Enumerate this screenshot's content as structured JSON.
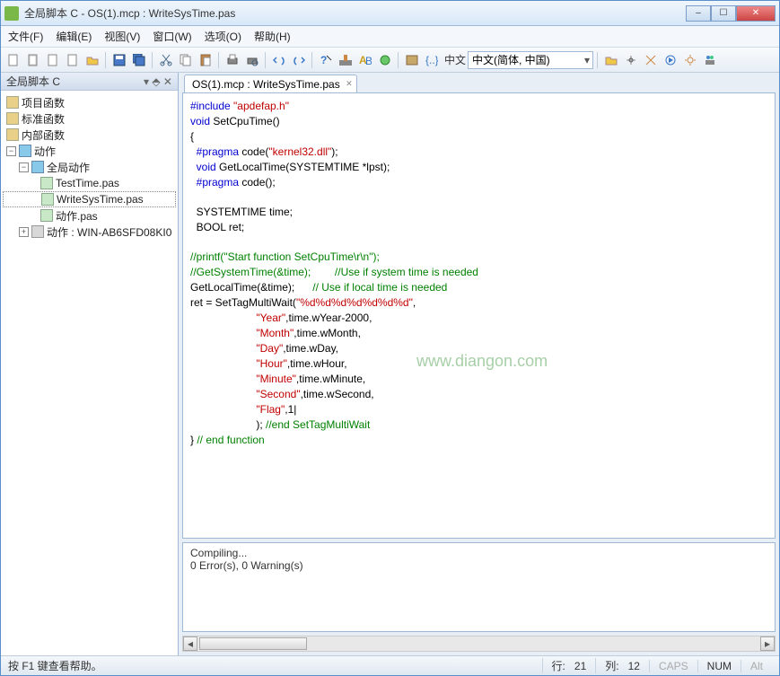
{
  "window": {
    "title": "全局脚本 C - OS(1).mcp : WriteSysTime.pas",
    "min": "–",
    "max": "☐",
    "close": "✕"
  },
  "menu": {
    "file": "文件(F)",
    "edit": "编辑(E)",
    "view": "视图(V)",
    "window": "窗口(W)",
    "options": "选项(O)",
    "help": "帮助(H)"
  },
  "toolbar": {
    "language_label": "中文(简体, 中国)"
  },
  "sidebar": {
    "title": "全局脚本 C",
    "pin": "▾  ⬘  ✕",
    "nodes": {
      "proj_fn": "项目函数",
      "std_fn": "标准函数",
      "int_fn": "内部函数",
      "actions": "动作",
      "global_actions": "全局动作",
      "file1": "TestTime.pas",
      "file2": "WriteSysTime.pas",
      "file3": "动作.pas",
      "host": "动作 : WIN-AB6SFD08KI0"
    }
  },
  "tab": {
    "label": "OS(1).mcp : WriteSysTime.pas"
  },
  "code": {
    "l1a": "#include ",
    "l1b": "\"apdefap.h\"",
    "l2a": "void",
    "l2b": " SetCpuTime()",
    "l3": "{",
    "l4a": "  #pragma",
    "l4b": " code(",
    "l4c": "\"kernel32.dll\"",
    "l4d": ");",
    "l5a": "  void",
    "l5b": " GetLocalTime(SYSTEMTIME *lpst);",
    "l6a": "  #pragma",
    "l6b": " code();",
    "l8": "  SYSTEMTIME time;",
    "l9": "  BOOL ret;",
    "l11": "//printf(\"Start function SetCpuTime\\r\\n\");",
    "l12a": "//GetSystemTime(&time);        //Use if system time is needed",
    "l13a": "GetLocalTime(&time);      ",
    "l13b": "// Use if local time is needed",
    "l14a": "ret = SetTagMultiWait(",
    "l14b": "\"%d%d%d%d%d%d%d\"",
    "l14c": ",",
    "l15a": "                      ",
    "l15b": "\"Year\"",
    "l15c": ",time.wYear-2000,",
    "l16a": "                      ",
    "l16b": "\"Month\"",
    "l16c": ",time.wMonth,",
    "l17a": "                      ",
    "l17b": "\"Day\"",
    "l17c": ",time.wDay,",
    "l18a": "                      ",
    "l18b": "\"Hour\"",
    "l18c": ",time.wHour,",
    "l19a": "                      ",
    "l19b": "\"Minute\"",
    "l19c": ",time.wMinute,",
    "l20a": "                      ",
    "l20b": "\"Second\"",
    "l20c": ",time.wSecond,",
    "l21a": "                      ",
    "l21b": "\"Flag\"",
    "l21c": ",1|",
    "l22a": "                      ); ",
    "l22b": "//end SetTagMultiWait",
    "l23a": "} ",
    "l23b": "// end function"
  },
  "watermark": "www.diangon.com",
  "output": {
    "l1": "Compiling...",
    "l2": "0 Error(s), 0 Warning(s)"
  },
  "status": {
    "help": "按 F1 键查看帮助。",
    "line_lbl": "行:",
    "line": "21",
    "col_lbl": "列:",
    "col": "12",
    "caps": "CAPS",
    "num": "NUM",
    "alt": "Alt"
  }
}
